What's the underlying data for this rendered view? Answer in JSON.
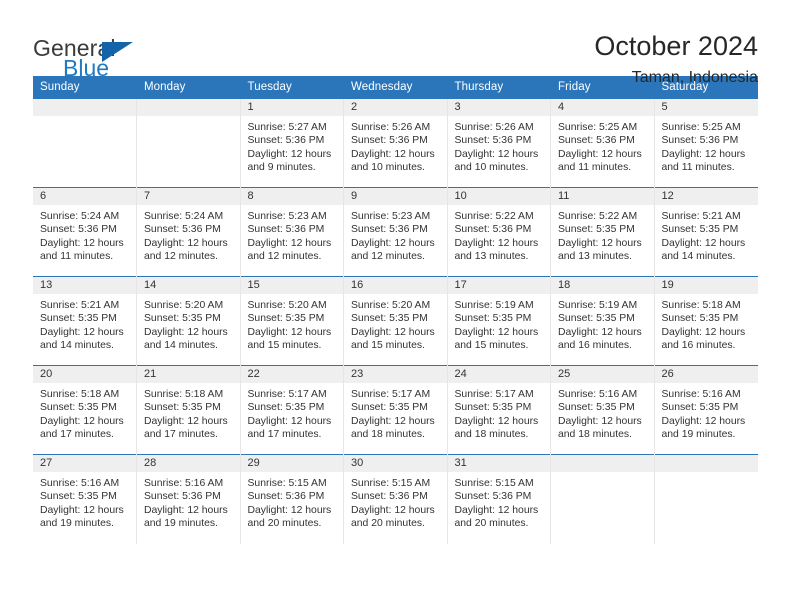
{
  "brand": {
    "name_top": "General",
    "name_bottom": "Blue",
    "accent_color": "#1464aa",
    "blue_text_color": "#1f7ac4"
  },
  "header": {
    "title": "October 2024",
    "subtitle": "Taman, Indonesia"
  },
  "calendar": {
    "header_bg": "#2b76bb",
    "header_text_color": "#ffffff",
    "daynum_band_bg": "#efefef",
    "weekday_headers": [
      "Sunday",
      "Monday",
      "Tuesday",
      "Wednesday",
      "Thursday",
      "Friday",
      "Saturday"
    ],
    "weeks": [
      [
        {
          "day": ""
        },
        {
          "day": ""
        },
        {
          "day": "1",
          "sunrise": "Sunrise: 5:27 AM",
          "sunset": "Sunset: 5:36 PM",
          "daylight_1": "Daylight: 12 hours",
          "daylight_2": "and 9 minutes."
        },
        {
          "day": "2",
          "sunrise": "Sunrise: 5:26 AM",
          "sunset": "Sunset: 5:36 PM",
          "daylight_1": "Daylight: 12 hours",
          "daylight_2": "and 10 minutes."
        },
        {
          "day": "3",
          "sunrise": "Sunrise: 5:26 AM",
          "sunset": "Sunset: 5:36 PM",
          "daylight_1": "Daylight: 12 hours",
          "daylight_2": "and 10 minutes."
        },
        {
          "day": "4",
          "sunrise": "Sunrise: 5:25 AM",
          "sunset": "Sunset: 5:36 PM",
          "daylight_1": "Daylight: 12 hours",
          "daylight_2": "and 11 minutes."
        },
        {
          "day": "5",
          "sunrise": "Sunrise: 5:25 AM",
          "sunset": "Sunset: 5:36 PM",
          "daylight_1": "Daylight: 12 hours",
          "daylight_2": "and 11 minutes."
        }
      ],
      [
        {
          "day": "6",
          "sunrise": "Sunrise: 5:24 AM",
          "sunset": "Sunset: 5:36 PM",
          "daylight_1": "Daylight: 12 hours",
          "daylight_2": "and 11 minutes."
        },
        {
          "day": "7",
          "sunrise": "Sunrise: 5:24 AM",
          "sunset": "Sunset: 5:36 PM",
          "daylight_1": "Daylight: 12 hours",
          "daylight_2": "and 12 minutes."
        },
        {
          "day": "8",
          "sunrise": "Sunrise: 5:23 AM",
          "sunset": "Sunset: 5:36 PM",
          "daylight_1": "Daylight: 12 hours",
          "daylight_2": "and 12 minutes."
        },
        {
          "day": "9",
          "sunrise": "Sunrise: 5:23 AM",
          "sunset": "Sunset: 5:36 PM",
          "daylight_1": "Daylight: 12 hours",
          "daylight_2": "and 12 minutes."
        },
        {
          "day": "10",
          "sunrise": "Sunrise: 5:22 AM",
          "sunset": "Sunset: 5:36 PM",
          "daylight_1": "Daylight: 12 hours",
          "daylight_2": "and 13 minutes."
        },
        {
          "day": "11",
          "sunrise": "Sunrise: 5:22 AM",
          "sunset": "Sunset: 5:35 PM",
          "daylight_1": "Daylight: 12 hours",
          "daylight_2": "and 13 minutes."
        },
        {
          "day": "12",
          "sunrise": "Sunrise: 5:21 AM",
          "sunset": "Sunset: 5:35 PM",
          "daylight_1": "Daylight: 12 hours",
          "daylight_2": "and 14 minutes."
        }
      ],
      [
        {
          "day": "13",
          "sunrise": "Sunrise: 5:21 AM",
          "sunset": "Sunset: 5:35 PM",
          "daylight_1": "Daylight: 12 hours",
          "daylight_2": "and 14 minutes."
        },
        {
          "day": "14",
          "sunrise": "Sunrise: 5:20 AM",
          "sunset": "Sunset: 5:35 PM",
          "daylight_1": "Daylight: 12 hours",
          "daylight_2": "and 14 minutes."
        },
        {
          "day": "15",
          "sunrise": "Sunrise: 5:20 AM",
          "sunset": "Sunset: 5:35 PM",
          "daylight_1": "Daylight: 12 hours",
          "daylight_2": "and 15 minutes."
        },
        {
          "day": "16",
          "sunrise": "Sunrise: 5:20 AM",
          "sunset": "Sunset: 5:35 PM",
          "daylight_1": "Daylight: 12 hours",
          "daylight_2": "and 15 minutes."
        },
        {
          "day": "17",
          "sunrise": "Sunrise: 5:19 AM",
          "sunset": "Sunset: 5:35 PM",
          "daylight_1": "Daylight: 12 hours",
          "daylight_2": "and 15 minutes."
        },
        {
          "day": "18",
          "sunrise": "Sunrise: 5:19 AM",
          "sunset": "Sunset: 5:35 PM",
          "daylight_1": "Daylight: 12 hours",
          "daylight_2": "and 16 minutes."
        },
        {
          "day": "19",
          "sunrise": "Sunrise: 5:18 AM",
          "sunset": "Sunset: 5:35 PM",
          "daylight_1": "Daylight: 12 hours",
          "daylight_2": "and 16 minutes."
        }
      ],
      [
        {
          "day": "20",
          "sunrise": "Sunrise: 5:18 AM",
          "sunset": "Sunset: 5:35 PM",
          "daylight_1": "Daylight: 12 hours",
          "daylight_2": "and 17 minutes."
        },
        {
          "day": "21",
          "sunrise": "Sunrise: 5:18 AM",
          "sunset": "Sunset: 5:35 PM",
          "daylight_1": "Daylight: 12 hours",
          "daylight_2": "and 17 minutes."
        },
        {
          "day": "22",
          "sunrise": "Sunrise: 5:17 AM",
          "sunset": "Sunset: 5:35 PM",
          "daylight_1": "Daylight: 12 hours",
          "daylight_2": "and 17 minutes."
        },
        {
          "day": "23",
          "sunrise": "Sunrise: 5:17 AM",
          "sunset": "Sunset: 5:35 PM",
          "daylight_1": "Daylight: 12 hours",
          "daylight_2": "and 18 minutes."
        },
        {
          "day": "24",
          "sunrise": "Sunrise: 5:17 AM",
          "sunset": "Sunset: 5:35 PM",
          "daylight_1": "Daylight: 12 hours",
          "daylight_2": "and 18 minutes."
        },
        {
          "day": "25",
          "sunrise": "Sunrise: 5:16 AM",
          "sunset": "Sunset: 5:35 PM",
          "daylight_1": "Daylight: 12 hours",
          "daylight_2": "and 18 minutes."
        },
        {
          "day": "26",
          "sunrise": "Sunrise: 5:16 AM",
          "sunset": "Sunset: 5:35 PM",
          "daylight_1": "Daylight: 12 hours",
          "daylight_2": "and 19 minutes."
        }
      ],
      [
        {
          "day": "27",
          "sunrise": "Sunrise: 5:16 AM",
          "sunset": "Sunset: 5:35 PM",
          "daylight_1": "Daylight: 12 hours",
          "daylight_2": "and 19 minutes."
        },
        {
          "day": "28",
          "sunrise": "Sunrise: 5:16 AM",
          "sunset": "Sunset: 5:36 PM",
          "daylight_1": "Daylight: 12 hours",
          "daylight_2": "and 19 minutes."
        },
        {
          "day": "29",
          "sunrise": "Sunrise: 5:15 AM",
          "sunset": "Sunset: 5:36 PM",
          "daylight_1": "Daylight: 12 hours",
          "daylight_2": "and 20 minutes."
        },
        {
          "day": "30",
          "sunrise": "Sunrise: 5:15 AM",
          "sunset": "Sunset: 5:36 PM",
          "daylight_1": "Daylight: 12 hours",
          "daylight_2": "and 20 minutes."
        },
        {
          "day": "31",
          "sunrise": "Sunrise: 5:15 AM",
          "sunset": "Sunset: 5:36 PM",
          "daylight_1": "Daylight: 12 hours",
          "daylight_2": "and 20 minutes."
        },
        {
          "day": ""
        },
        {
          "day": ""
        }
      ]
    ]
  }
}
